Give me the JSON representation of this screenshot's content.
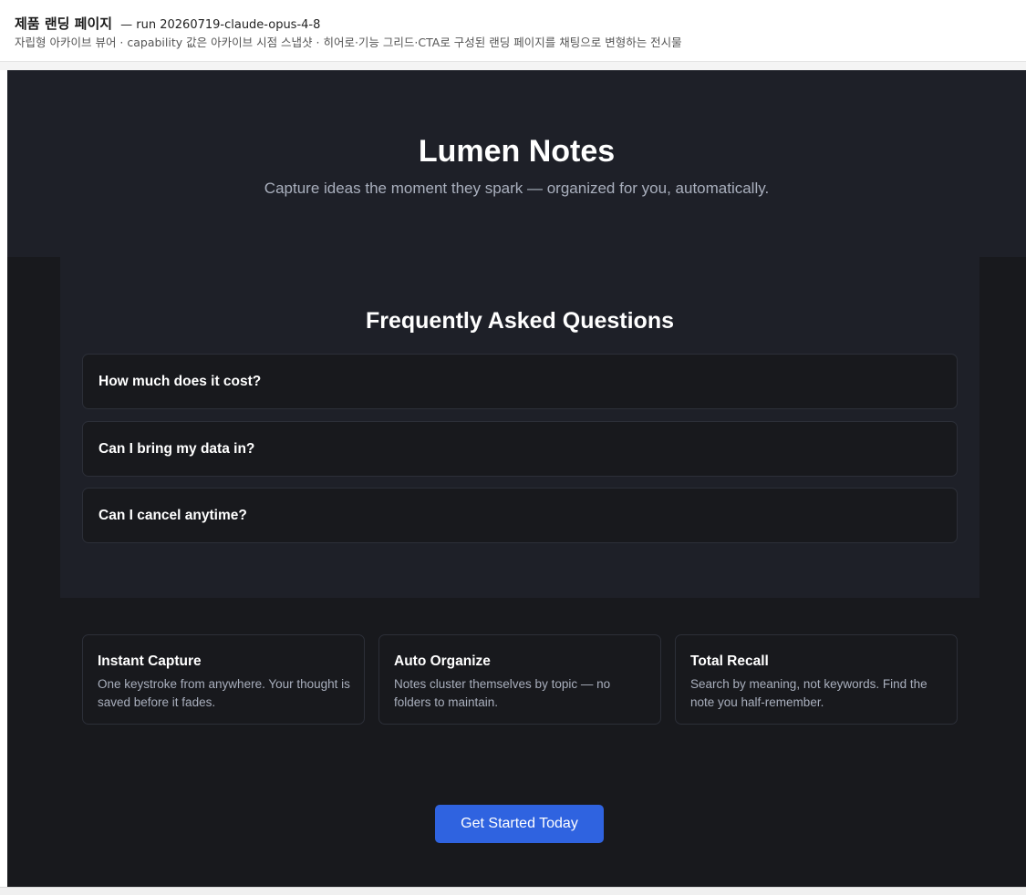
{
  "header": {
    "title": "제품 랜딩 페이지",
    "run_label": "— run 20260719-claude-opus-4-8",
    "subtitle": "자립형 아카이브 뷰어 · capability 값은 아카이브 시점 스냅샷 · 히어로·기능 그리드·CTA로 구성된 랜딩 페이지를 채팅으로 변형하는 전시물"
  },
  "hero": {
    "title": "Lumen Notes",
    "tagline": "Capture ideas the moment they spark — organized for you, automatically."
  },
  "faq": {
    "title": "Frequently Asked Questions",
    "items": [
      {
        "question": "How much does it cost?"
      },
      {
        "question": "Can I bring my data in?"
      },
      {
        "question": "Can I cancel anytime?"
      }
    ]
  },
  "features": [
    {
      "title": "Instant Capture",
      "description": "One keystroke from anywhere. Your thought is saved before it fades."
    },
    {
      "title": "Auto Organize",
      "description": "Notes cluster themselves by topic — no folders to maintain."
    },
    {
      "title": "Total Recall",
      "description": "Search by meaning, not keywords. Find the note you half-remember."
    }
  ],
  "cta": {
    "label": "Get Started Today"
  },
  "colors": {
    "background": "#18191d",
    "surface": "#1e2028",
    "accent": "#2f63e0",
    "text_muted": "#a9afbd"
  }
}
